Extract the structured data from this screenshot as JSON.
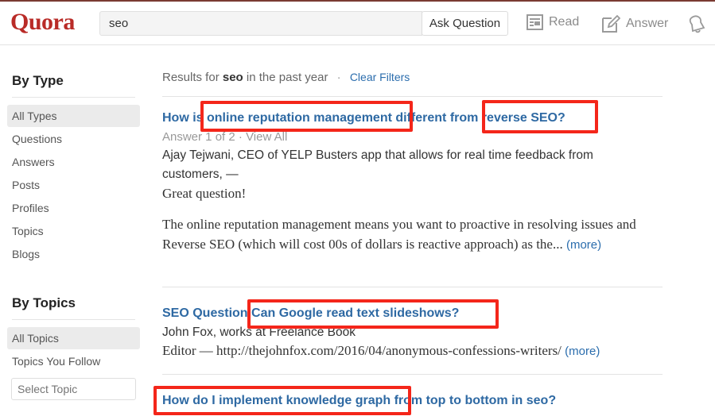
{
  "header": {
    "logo": "Quora",
    "search_value": "seo",
    "ask_button": "Ask Question",
    "nav": [
      {
        "label": "Read",
        "icon": "read-icon"
      },
      {
        "label": "Answer",
        "icon": "answer-pencil-icon"
      },
      {
        "label": "",
        "icon": "bell-icon"
      }
    ]
  },
  "sidebar": {
    "by_type": {
      "heading": "By Type",
      "items": [
        {
          "label": "All Types",
          "active": true
        },
        {
          "label": "Questions"
        },
        {
          "label": "Answers"
        },
        {
          "label": "Posts"
        },
        {
          "label": "Profiles"
        },
        {
          "label": "Topics"
        },
        {
          "label": "Blogs"
        }
      ]
    },
    "by_topics": {
      "heading": "By Topics",
      "items": [
        {
          "label": "All Topics",
          "active": true
        },
        {
          "label": "Topics You Follow"
        }
      ],
      "select_placeholder": "Select Topic"
    }
  },
  "results": {
    "prefix": "Results for",
    "query": "seo",
    "suffix": "in the past year",
    "separator": "·",
    "clear_filters": "Clear Filters",
    "items": [
      {
        "title": "How is online reputation management different from reverse SEO?",
        "meta_answer": "Answer 1 of 2",
        "meta_sep": " · ",
        "meta_view_all": "View All",
        "author": "Ajay Tejwani, CEO of YELP Busters app that allows for real time feedback from customers, —",
        "snippet_line1": "Great question!",
        "snippet_para": "The online reputation management means you want to proactive in resolving issues and Reverse SEO (which will cost 00s of dollars is reactive approach) as the...",
        "more": "(more)"
      },
      {
        "title_prefix": "SEO Question",
        "title": "Can Google read text slideshows?",
        "author": "John Fox, works at Freelance Book",
        "snippet": "Editor — http://thejohnfox.com/2016/04/anonymous-confessions-writers/",
        "more": "(more)"
      },
      {
        "title": "How do I implement knowledge graph from top to bottom in seo?"
      }
    ]
  },
  "annotation_color": "#f4261a"
}
